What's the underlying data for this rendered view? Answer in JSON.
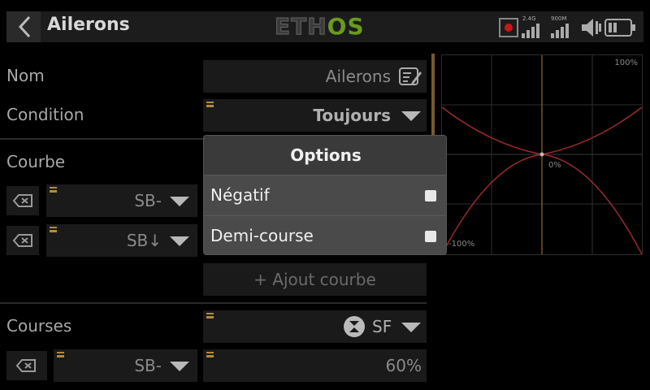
{
  "header": {
    "title": "Ailerons",
    "logo_left": "ETH",
    "logo_right": "OS",
    "rx1": "2.4G",
    "rx2": "900M"
  },
  "name_row": {
    "label": "Nom",
    "value": "Ailerons"
  },
  "condition_row": {
    "label": "Condition",
    "value": "Toujours"
  },
  "curve_section": {
    "label": "Courbe",
    "source1": "SB-",
    "source2": "SB↓",
    "add_label": "+ Ajout courbe"
  },
  "courses_section": {
    "label": "Courses",
    "source": "SF",
    "sub_source": "SB-",
    "value": "60%"
  },
  "graph": {
    "top_label": "100%",
    "mid_label": "0%",
    "bottom_label": "-100%"
  },
  "dialog": {
    "title": "Options",
    "options": [
      {
        "label": "Négatif",
        "checked": false
      },
      {
        "label": "Demi-course",
        "checked": false
      }
    ]
  },
  "colors": {
    "accent": "#6a9a1e",
    "marker": "#b48a3c",
    "curve": "#a33a2a"
  }
}
